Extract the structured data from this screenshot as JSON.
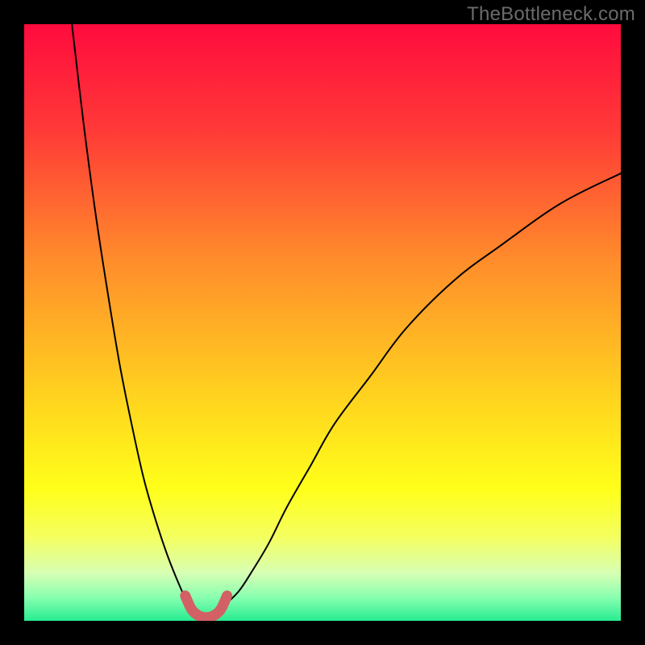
{
  "watermark": "TheBottleneck.com",
  "chart_data": {
    "type": "line",
    "title": "",
    "xlabel": "",
    "ylabel": "",
    "xlim": [
      0,
      100
    ],
    "ylim": [
      0,
      100
    ],
    "background_gradient": {
      "stops": [
        {
          "offset": 0,
          "color": "#ff0b3e"
        },
        {
          "offset": 18,
          "color": "#ff3a37"
        },
        {
          "offset": 40,
          "color": "#ff8e2b"
        },
        {
          "offset": 62,
          "color": "#ffd21f"
        },
        {
          "offset": 78,
          "color": "#ffff1a"
        },
        {
          "offset": 86,
          "color": "#f4ff60"
        },
        {
          "offset": 92,
          "color": "#d7ffb4"
        },
        {
          "offset": 96,
          "color": "#8affb0"
        },
        {
          "offset": 100,
          "color": "#27ec92"
        }
      ]
    },
    "series": [
      {
        "name": "curve-left",
        "color": "#000000",
        "stroke_width": 2,
        "x": [
          8,
          10,
          12,
          14,
          16,
          18,
          20,
          22,
          24,
          26,
          27,
          28
        ],
        "y": [
          100,
          83,
          68,
          55,
          43,
          33,
          24,
          17,
          11,
          6,
          4,
          3
        ]
      },
      {
        "name": "curve-right",
        "color": "#000000",
        "stroke_width": 2,
        "x": [
          34,
          36,
          38,
          41,
          44,
          48,
          52,
          58,
          64,
          72,
          80,
          90,
          100
        ],
        "y": [
          3,
          5,
          8,
          13,
          19,
          26,
          33,
          41,
          49,
          57,
          63,
          70,
          75
        ]
      },
      {
        "name": "valley-highlight",
        "color": "#d26064",
        "stroke_width": 13,
        "x": [
          27,
          28,
          29,
          30,
          31,
          32,
          33,
          34
        ],
        "y": [
          4.2,
          2.0,
          1.0,
          0.6,
          0.6,
          1.0,
          2.0,
          4.2
        ]
      }
    ]
  }
}
